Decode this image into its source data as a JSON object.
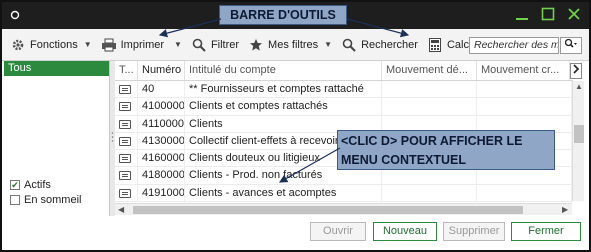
{
  "window": {
    "icon": "ring-icon"
  },
  "annotations": {
    "toolbar_callout": "BARRE D'OUTILS",
    "menu_callout_line1": "<CLIC D> POUR AFFICHER LE",
    "menu_callout_line2": "MENU CONTEXTUEL"
  },
  "toolbar": {
    "fonctions": "Fonctions",
    "imprimer": "Imprimer",
    "filtrer": "Filtrer",
    "mes_filtres": "Mes filtres",
    "rechercher": "Rechercher",
    "calculer": "Calculer",
    "search_placeholder": "Rechercher des mo"
  },
  "sidebar": {
    "selected": "Tous",
    "actifs": "Actifs",
    "actifs_checked": true,
    "en_sommeil": "En sommeil",
    "en_sommeil_checked": false
  },
  "grid": {
    "columns": [
      "T...",
      "Numéro",
      "Intitulé du compte",
      "Mouvement dé...",
      "Mouvement cr..."
    ],
    "rows": [
      {
        "numero": "40",
        "intitule": "** Fournisseurs et comptes rattaché"
      },
      {
        "numero": "41000000",
        "intitule": "Clients et comptes rattachés"
      },
      {
        "numero": "41100000",
        "intitule": "Clients"
      },
      {
        "numero": "41300000",
        "intitule": "Collectif client-effets à recevoir"
      },
      {
        "numero": "41600000",
        "intitule": "Clients douteux ou litigieux"
      },
      {
        "numero": "41800000",
        "intitule": "Clients - Prod. non facturés"
      },
      {
        "numero": "41910000",
        "intitule": "Clients - avances et acomptes"
      }
    ]
  },
  "footer": {
    "ouvrir": "Ouvrir",
    "nouveau": "Nouveau",
    "supprimer": "Supprimer",
    "fermer": "Fermer"
  },
  "colors": {
    "accent": "#2b8a3e",
    "window_controls": "#6ed34a",
    "callout_fill": "#8fa6c7"
  }
}
